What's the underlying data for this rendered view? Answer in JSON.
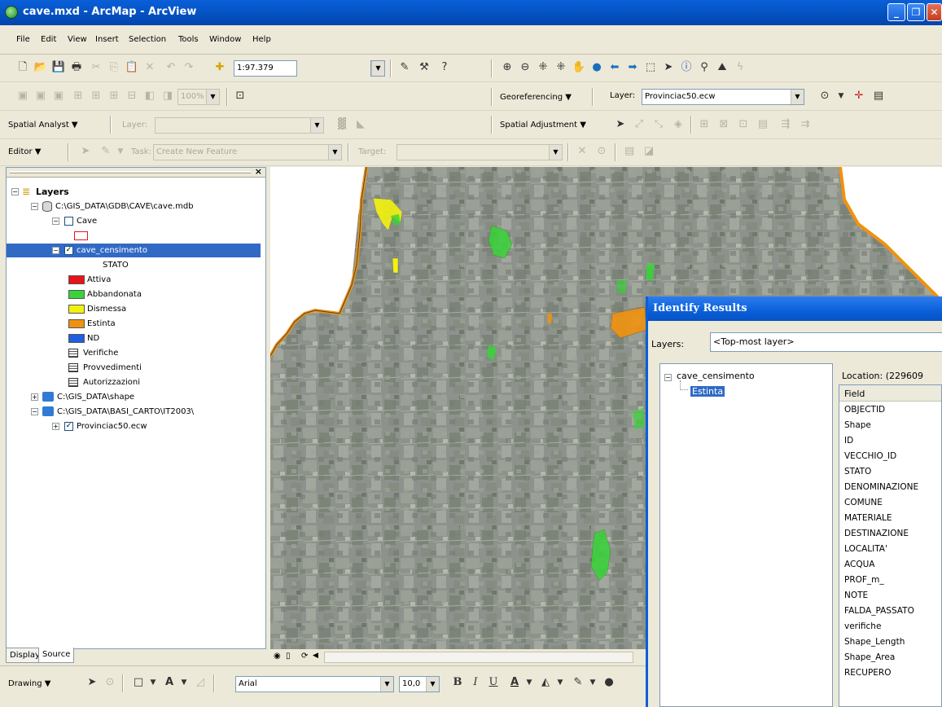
{
  "window": {
    "title": "cave.mxd - ArcMap - ArcView"
  },
  "menu": [
    "File",
    "Edit",
    "View",
    "Insert",
    "Selection",
    "Tools",
    "Window",
    "Help"
  ],
  "standard_toolbar": {
    "scale": "1:97.379"
  },
  "georef_toolbar": {
    "menu_label": "Georeferencing",
    "layer_label": "Layer:",
    "layer_value": "Provinciac50.ecw"
  },
  "spatial_analyst": {
    "menu_label": "Spatial Analyst",
    "layer_label": "Layer:"
  },
  "spatial_adjustment": {
    "menu_label": "Spatial Adjustment"
  },
  "editor": {
    "menu_label": "Editor",
    "task_label": "Task:",
    "task_value": "Create New Feature",
    "target_label": "Target:",
    "zoom_value": "100%"
  },
  "toc": {
    "root_label": "Layers",
    "db_path": "C:\\GIS_DATA\\GDB\\CAVE\\cave.mdb",
    "layer_cave": "Cave",
    "layer_censimento": "cave_censimento",
    "legend_field": "STATO",
    "legend": [
      {
        "label": "Attiva",
        "color": "#e8141b"
      },
      {
        "label": "Abbandonata",
        "color": "#38d338"
      },
      {
        "label": "Dismessa",
        "color": "#f2f20e"
      },
      {
        "label": "Estinta",
        "color": "#f0920f"
      },
      {
        "label": "ND",
        "color": "#1f5fe0"
      }
    ],
    "tables": [
      "Verifiche",
      "Provvedimenti",
      "Autorizzazioni"
    ],
    "shape_path": "C:\\GIS_DATA\\shape",
    "basi_path": "C:\\GIS_DATA\\BASI_CARTO\\IT2003\\",
    "raster_layer": "Provinciac50.ecw",
    "tabs": [
      "Display",
      "Source"
    ]
  },
  "drawing": {
    "menu_label": "Drawing",
    "font": "Arial",
    "font_size": "10,0",
    "bold": "B",
    "italic": "I",
    "underline": "U",
    "font_color": "A"
  },
  "identify": {
    "title": "Identify Results",
    "layers_label": "Layers:",
    "layers_value": "<Top-most layer>",
    "tree_root": "cave_censimento",
    "tree_child": "Estinta",
    "location": "Location: (229609",
    "field_header": "Field",
    "fields": [
      "OBJECTID",
      "Shape",
      "ID",
      "VECCHIO_ID",
      "STATO",
      "DENOMINAZIONE",
      "COMUNE",
      "MATERIALE",
      "DESTINAZIONE",
      "LOCALITA'",
      "ACQUA",
      "PROF_m_",
      "NOTE",
      "FALDA_PASSATO",
      "verifiche",
      "Shape_Length",
      "Shape_Area",
      "RECUPERO"
    ]
  }
}
